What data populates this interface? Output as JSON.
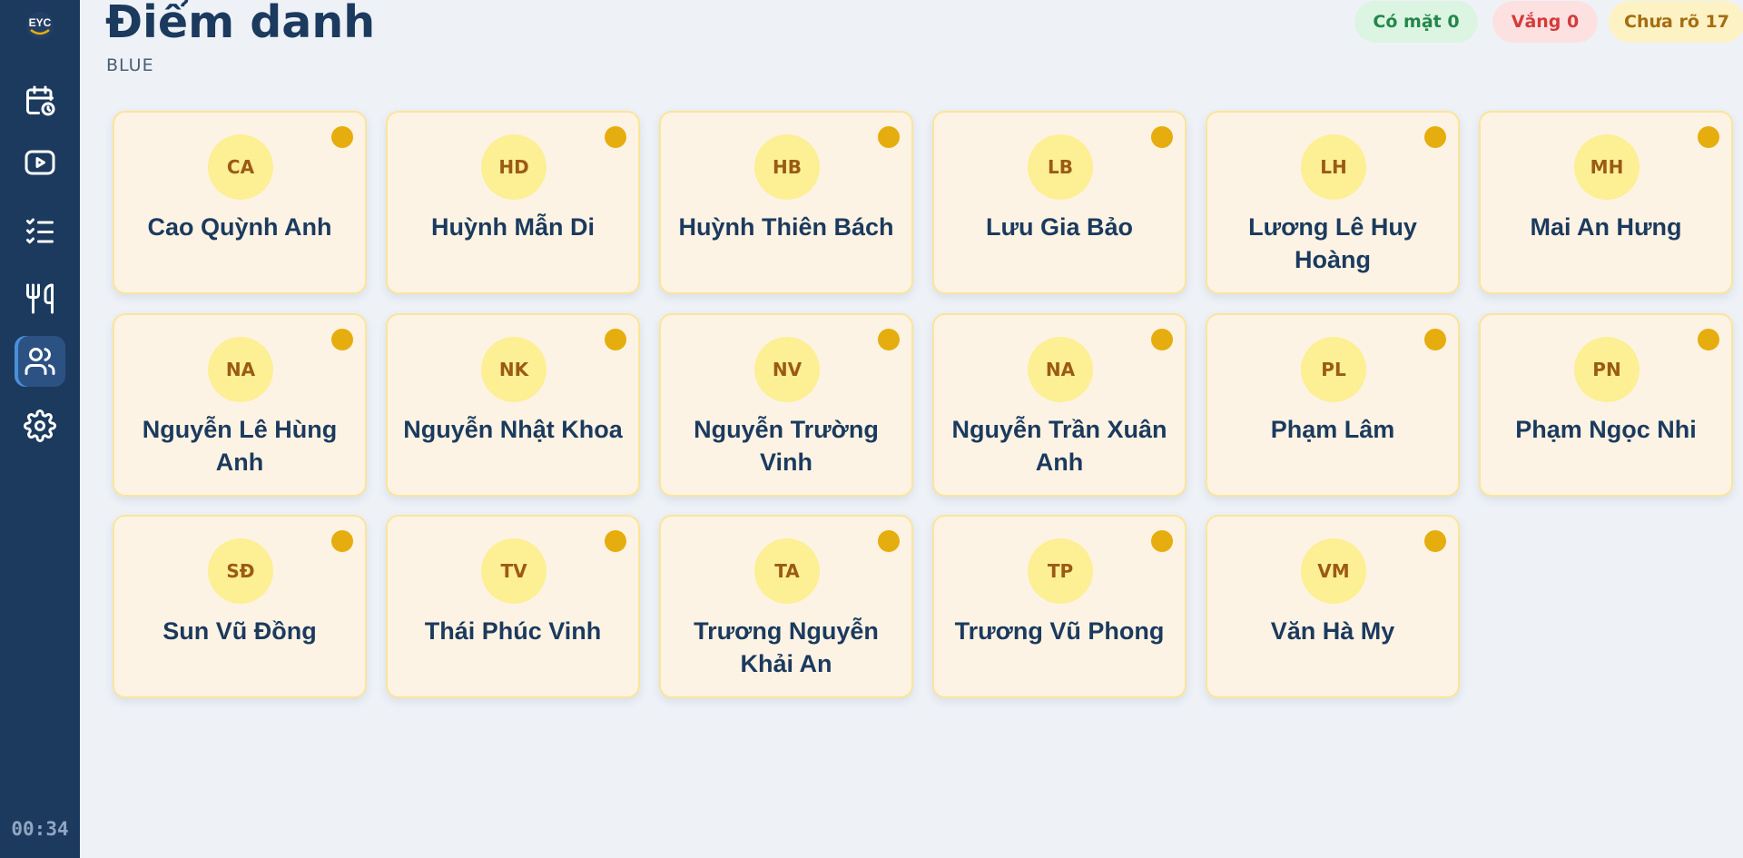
{
  "app": {
    "logo_text": "EYC"
  },
  "header": {
    "title": "Điểm danh",
    "subtitle": "BLUE"
  },
  "status": {
    "present_label": "Có mặt 0",
    "absent_label": "Vắng 0",
    "unknown_label": "Chưa rõ 17",
    "colors": {
      "present": "#23874a",
      "absent": "#d43b3b",
      "unknown": "#a46d11"
    }
  },
  "sidebar": {
    "items": [
      {
        "icon": "calendar-clock-icon"
      },
      {
        "icon": "video-play-icon"
      },
      {
        "icon": "checklist-icon"
      },
      {
        "icon": "utensils-icon"
      },
      {
        "icon": "users-icon",
        "active": true
      },
      {
        "icon": "gear-icon"
      }
    ],
    "clock": "00:34"
  },
  "students": [
    {
      "initials": "CA",
      "name": "Cao Quỳnh Anh"
    },
    {
      "initials": "HD",
      "name": "Huỳnh Mẫn Di"
    },
    {
      "initials": "HB",
      "name": "Huỳnh Thiên Bách"
    },
    {
      "initials": "LB",
      "name": "Lưu Gia Bảo"
    },
    {
      "initials": "LH",
      "name": "Lương Lê Huy Hoàng"
    },
    {
      "initials": "MH",
      "name": "Mai An Hưng"
    },
    {
      "initials": "NA",
      "name": "Nguyễn Lê Hùng Anh"
    },
    {
      "initials": "NK",
      "name": "Nguyễn Nhật Khoa"
    },
    {
      "initials": "NV",
      "name": "Nguyễn Trường Vinh"
    },
    {
      "initials": "NA",
      "name": "Nguyễn Trần Xuân Anh"
    },
    {
      "initials": "PL",
      "name": "Phạm Lâm"
    },
    {
      "initials": "PN",
      "name": "Phạm Ngọc Nhi"
    },
    {
      "initials": "SĐ",
      "name": "Sun Vũ Đồng"
    },
    {
      "initials": "TV",
      "name": "Thái Phúc Vinh"
    },
    {
      "initials": "TA",
      "name": "Trương Nguyễn Khải An"
    },
    {
      "initials": "TP",
      "name": "Trương Vũ Phong"
    },
    {
      "initials": "VM",
      "name": "Văn Hà My"
    }
  ]
}
